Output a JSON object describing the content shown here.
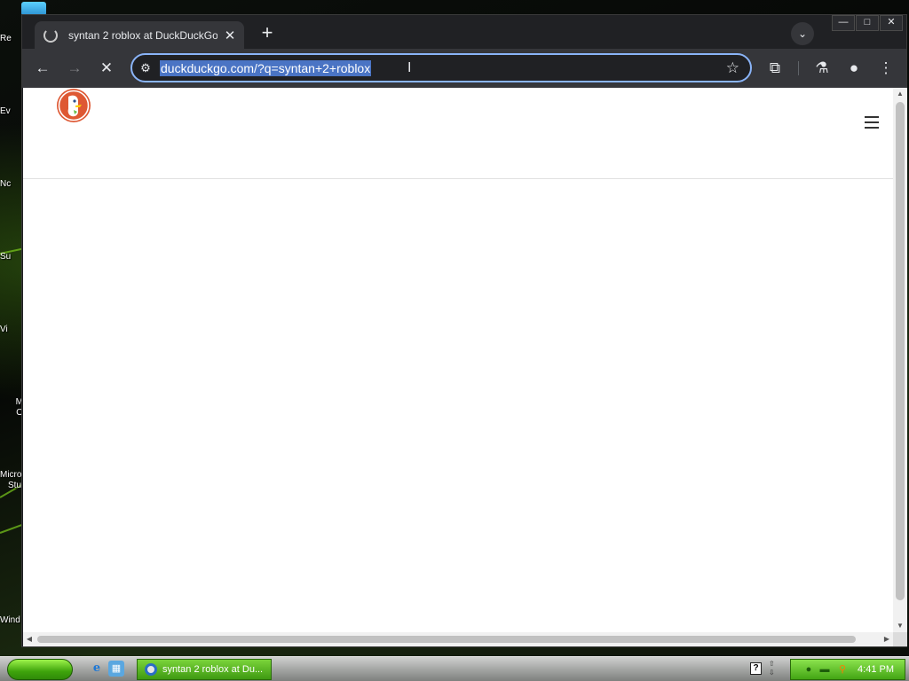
{
  "desktop": {
    "icons": [
      {
        "label": "Re"
      },
      {
        "label": "Ev"
      },
      {
        "label": "Nc"
      },
      {
        "label": "Su"
      },
      {
        "label": "Vi"
      },
      {
        "label": "M",
        "label2": "O"
      },
      {
        "label": "Micro",
        "label2": "Stu"
      },
      {
        "label": "Wind"
      }
    ]
  },
  "browser": {
    "tab": {
      "title": "syntan 2 roblox at DuckDuckGo",
      "close_glyph": "✕",
      "favicon": "loading-spinner-icon"
    },
    "new_tab_glyph": "+",
    "tab_search_glyph": "⌄",
    "window_controls": {
      "minimize": "—",
      "maximize": "□",
      "close": "✕"
    },
    "toolbar": {
      "back_glyph": "←",
      "forward_glyph": "→",
      "stop_glyph": "✕",
      "site_info_glyph": "⚙",
      "url": "duckduckgo.com/?q=syntan+2+roblox",
      "url_selected": true,
      "caret_glyph": "I",
      "bookmark_glyph": "☆",
      "extensions_glyph": "⧉",
      "labs_glyph": "⚗",
      "profile_glyph": "●",
      "menu_glyph": "⋮"
    },
    "page": {
      "site": "DuckDuckGo",
      "logo_icon": "duckduckgo-logo-icon",
      "menu_icon": "hamburger-menu-icon"
    },
    "scrollbars": {
      "up": "▲",
      "down": "▼",
      "left": "◀",
      "right": "▶"
    }
  },
  "taskbar": {
    "ie_glyph": "e",
    "desktop_glyph": "▦",
    "task_button_label": "syntan 2 roblox at Du...",
    "help_glyph": "?",
    "tray_arrows_up": "⇧",
    "tray_arrows_down": "⇩",
    "clock": "4:41 PM"
  },
  "colors": {
    "accent": "#8ab4f8",
    "selection": "#4a74c4",
    "toolbar_bg": "#35363a",
    "titlebar_bg": "#202124",
    "ddg_orange": "#de5833",
    "taskbar_green": "#43a514"
  }
}
